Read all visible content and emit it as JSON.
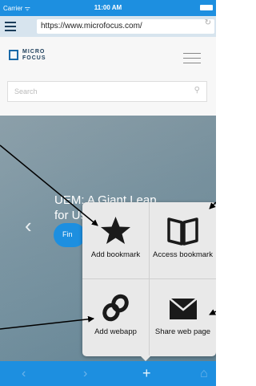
{
  "status_bar": {
    "carrier": "Carrier ᯤ",
    "time": "11:00 AM"
  },
  "browser": {
    "url": "https://www.microfocus.com/"
  },
  "site": {
    "logo_text_line1": "MICRO",
    "logo_text_line2": "FOCUS",
    "search_placeholder": "Search"
  },
  "hero": {
    "title_line1": "UEM: A Giant Leap",
    "title_line2": "for User Productivity",
    "cta_label": "Fin"
  },
  "popup": {
    "items": [
      {
        "label": "Add bookmark",
        "icon": "star-icon"
      },
      {
        "label": "Access bookmark",
        "icon": "book-icon"
      },
      {
        "label": "Add webapp",
        "icon": "link-icon"
      },
      {
        "label": "Share web page",
        "icon": "envelope-icon"
      }
    ]
  },
  "toolbar": {
    "icons": [
      "back-icon",
      "forward-icon",
      "plus-icon",
      "home-icon"
    ]
  },
  "colors": {
    "accent": "#1d8fe0",
    "popup_bg": "#e9e9e9"
  }
}
